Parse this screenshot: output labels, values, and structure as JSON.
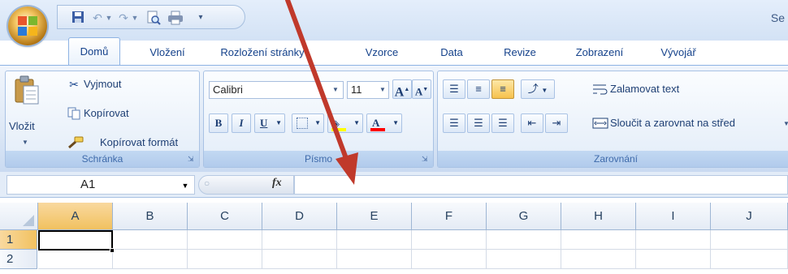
{
  "window": {
    "title_partial": "Se"
  },
  "quick_access": {
    "icons": [
      "save-icon",
      "undo-icon",
      "redo-icon",
      "print-preview-icon",
      "print-icon",
      "customize-icon"
    ]
  },
  "tabs": [
    {
      "label": "Domů",
      "active": true
    },
    {
      "label": "Vložení"
    },
    {
      "label": "Rozložení stránky"
    },
    {
      "label": "Vzorce"
    },
    {
      "label": "Data"
    },
    {
      "label": "Revize"
    },
    {
      "label": "Zobrazení"
    },
    {
      "label": "Vývojář"
    }
  ],
  "clipboard": {
    "group_label": "Schránka",
    "paste_label": "Vložit",
    "cut_label": "Vyjmout",
    "copy_label": "Kopírovat",
    "format_painter_label": "Kopírovat formát"
  },
  "font": {
    "group_label": "Písmo",
    "font_name": "Calibri",
    "font_size": "11",
    "grow_label": "A",
    "shrink_label": "A",
    "bold_label": "B",
    "italic_label": "I",
    "underline_label": "U",
    "font_color_label": "A"
  },
  "alignment": {
    "group_label": "Zarovnání",
    "wrap_label": "Zalamovat text",
    "merge_label": "Sloučit a zarovnat na střed"
  },
  "formula_bar": {
    "name_box": "A1",
    "fx_label": "fx",
    "formula": ""
  },
  "grid": {
    "columns": [
      "A",
      "B",
      "C",
      "D",
      "E",
      "F",
      "G",
      "H",
      "I",
      "J"
    ],
    "rows": [
      "1",
      "2"
    ],
    "selected_cell": "A1"
  },
  "colors": {
    "annotation_arrow": "#c0392b",
    "accent": "#15428b",
    "selection": "#f1c15f"
  }
}
